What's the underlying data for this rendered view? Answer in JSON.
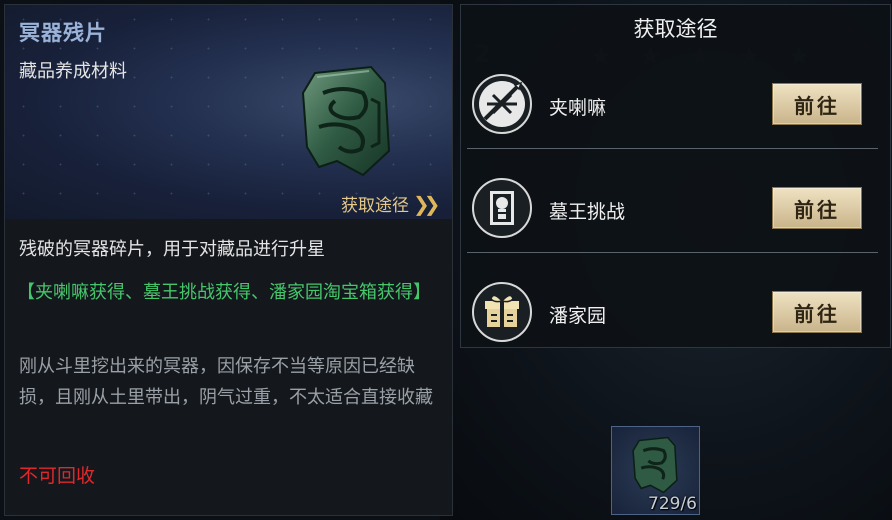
{
  "item": {
    "name": "冥器残片",
    "category": "藏品养成材料",
    "obtain_link_label": "获取途径",
    "description": "残破的冥器碎片，用于对藏品进行升星",
    "sources": "【夹喇嘛获得、墓王挑战获得、潘家园淘宝箱获得】",
    "lore": "刚从斗里挖出来的冥器，因保存不当等原因已经缺损，且刚从土里带出，阴气过重，不太适合直接收藏",
    "recycle_status": "不可回收"
  },
  "obtain_panel": {
    "title": "获取途径",
    "paths": [
      {
        "label": "夹喇嘛",
        "icon": "sword-shield-icon",
        "button": "前往"
      },
      {
        "label": "墓王挑战",
        "icon": "tomb-king-icon",
        "button": "前往"
      },
      {
        "label": "潘家园",
        "icon": "treasure-box-icon",
        "button": "前往"
      }
    ]
  },
  "inventory": {
    "count": "729/6"
  },
  "colors": {
    "accent_gold": "#e6c987",
    "source_green": "#46c66b",
    "warning_red": "#e0282b",
    "title_blue": "#9bb3d9"
  }
}
